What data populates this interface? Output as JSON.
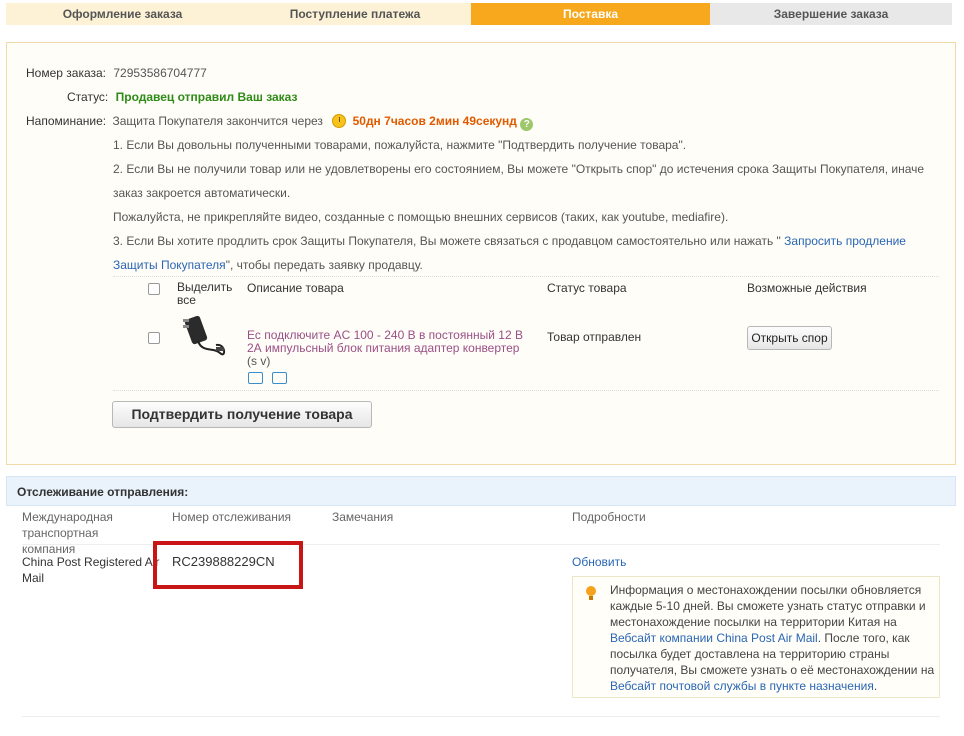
{
  "steps": [
    {
      "label": "Оформление заказа",
      "state": "done"
    },
    {
      "label": "Поступление платежа",
      "state": "done"
    },
    {
      "label": "Поставка",
      "state": "active"
    },
    {
      "label": "Завершение заказа",
      "state": "todo"
    }
  ],
  "colors": {
    "active_step": "#f7a81c",
    "done_step": "#fdf2d6",
    "status_green": "#2e8b15",
    "timer": "#e05a00",
    "link": "#2a66b5",
    "highlight": "#c81616"
  },
  "order": {
    "number_label": "Номер заказа:",
    "number": "72953586704777",
    "status_label": "Статус:",
    "status": "Продавец отправил Ваш заказ",
    "reminder_label": "Напоминание:",
    "reminder_prefix": "Защита Покупателя закончится через",
    "timer": "50дн 7часов 2мин 49секунд",
    "help_icon": "question-icon",
    "note1": "1. Если Вы довольны полученными товарами, пожалуйста, нажмите \"Подтвердить получение товара\".",
    "note2a": "2. Если Вы не получили товар или не удовлетворены его состоянием, Вы можете \"Открыть спор\" до истечения срока Защиты Покупателя, иначе",
    "note2b": "заказ закроется автоматически.",
    "note2c": "Пожалуйста, не прикрепляйте видео, созданные с помощью внешних сервисов (таких, как youtube, mediafire).",
    "note3a": "3. Если Вы хотите продлить срок Защиты Покупателя, Вы можете связаться с продавцом самостоятельно или нажать \"",
    "note3_link1": "Запросить продление",
    "note3_link2": "Защиты Покупателя",
    "note3b": "\", чтобы передать заявку продавцу."
  },
  "items_table": {
    "headers": {
      "select_all": "Выделить все",
      "description": "Описание товара",
      "status": "Статус товара",
      "actions": "Возможные действия"
    },
    "rows": [
      {
        "description": "Ес подключите AC 100 - 240 В в постоянный 12 В 2А импульсный блок питания адаптер конвертер",
        "variant": "(s v)",
        "status": "Товар отправлен",
        "action": "Открыть спор"
      }
    ],
    "confirm_button": "Подтвердить получение товара"
  },
  "tracking": {
    "title": "Отслеживание отправления:",
    "headers": {
      "carrier": "Международная транспортная компания",
      "tracking_no": "Номер отслеживания",
      "remarks": "Замечания",
      "details": "Подробности"
    },
    "row": {
      "carrier_a": "China Post Registered Air",
      "carrier_b": "Mail",
      "tracking_no": "RC239888229CN",
      "update_link": "Обновить"
    },
    "info": {
      "t1": "Информация о местонахождении посылки обновляется каждые 5-10 дней. Вы сможете узнать статус отправки и местонахождение посылки на территории Китая на",
      "link1": "Вебсайт компании China Post Air Mail",
      "t2": ". После того, как посылка будет доставлена на территорию страны получателя, Вы сможете узнать о её местонахождении на",
      "link2": "Вебсайт почтовой службы в пункте назначения",
      "t3": "."
    }
  }
}
